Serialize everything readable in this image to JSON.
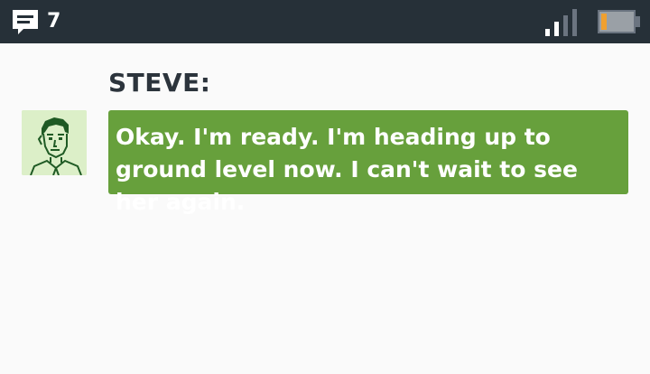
{
  "status_bar": {
    "message_count": "7",
    "icons": {
      "messages": "message-bubble-icon",
      "signal": "signal-strength-icon",
      "battery": "battery-low-icon"
    },
    "colors": {
      "background": "#263038",
      "battery_level": "#f0a030"
    }
  },
  "dialogue": {
    "speaker": "STEVE:",
    "avatar": "steve-portrait",
    "message": "Okay. I'm ready. I'm heading up to ground level now. I can't wait to see her again.",
    "colors": {
      "bubble": "#67a03c",
      "avatar_bg": "#dcefc8"
    }
  }
}
